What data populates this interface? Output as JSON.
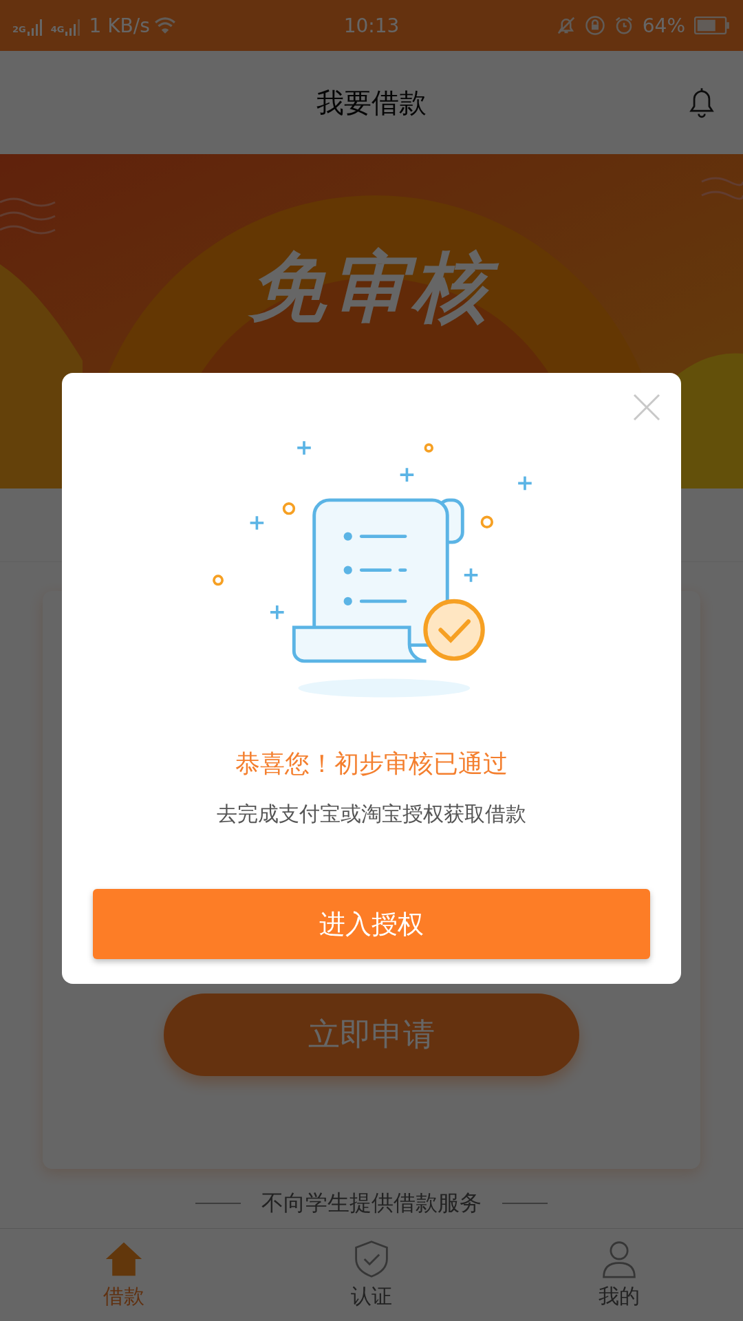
{
  "status_bar": {
    "network_1": "2G",
    "network_2": "4G",
    "speed": "1 KB/s",
    "time": "10:13",
    "battery": "64%"
  },
  "header": {
    "title": "我要借款"
  },
  "banner": {
    "kind": "picture",
    "headline": "免审核"
  },
  "apply_button": "立即申请",
  "notice": "不向学生提供借款服务",
  "bottom_nav": [
    {
      "label": "借款",
      "kind": "loan",
      "selected": true
    },
    {
      "label": "认证",
      "kind": "verify",
      "selected": false
    },
    {
      "label": "我的",
      "kind": "profile",
      "selected": false
    }
  ],
  "dialog": {
    "title": "恭喜您！初步审核已通过",
    "message": "去完成支付宝或淘宝授权获取借款",
    "button": "进入授权"
  }
}
